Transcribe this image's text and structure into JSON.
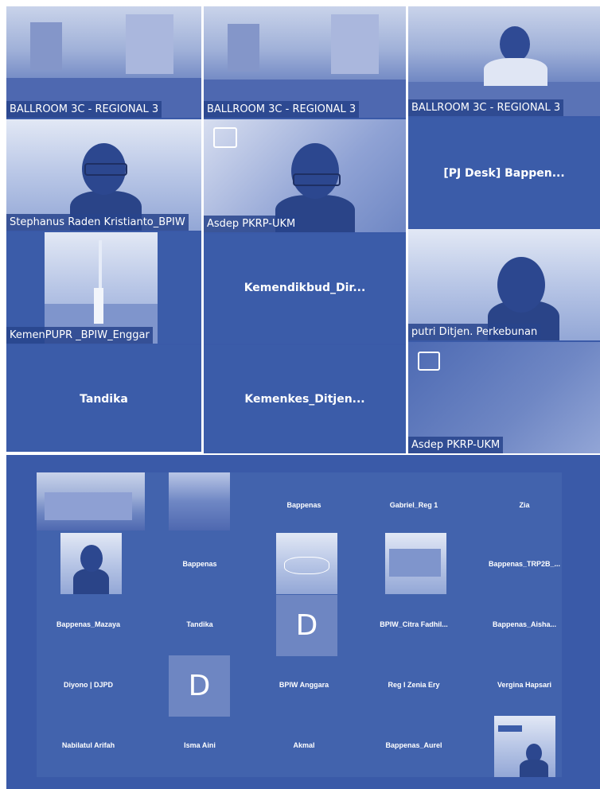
{
  "colors": {
    "panel_bg": "#3a5aa8",
    "tile_bg": "#3b5ca9",
    "text": "#ffffff"
  },
  "top_left": {
    "room_label": "BALLROOM 3C - REGIONAL 3",
    "person1_label": "Stephanus Raden Kristianto_BPIW",
    "person2_label": "KemenPUPR _BPIW_Enggar",
    "tile_name": "Tandika"
  },
  "top_middle": {
    "room_label": "BALLROOM 3C - REGIONAL 3",
    "person_label": "Asdep PKRP-UKM",
    "tile1_name": "Kemendikbud_Dir...",
    "tile2_name": "Kemenkes_Ditjen..."
  },
  "top_right": {
    "room_label": "BALLROOM 3C - REGIONAL 3",
    "tile_name": "[PJ Desk]  Bappen...",
    "person_label": "putri Ditjen. Perkebunan",
    "bottom_label": "Asdep PKRP-UKM"
  },
  "bottom_grid": {
    "row1": [
      "Bappenas",
      "Gabriel_Reg 1",
      "Zia"
    ],
    "row2": [
      "Bappenas",
      "Bappenas_TRP2B_..."
    ],
    "row3": [
      "Bappenas_Mazaya",
      "Tandika",
      "BPIW_Citra  Fadhil...",
      "Bappenas_Aisha..."
    ],
    "row4": [
      "Diyono | DJPD",
      "BPIW Anggara",
      "Reg I Zenia Ery",
      "Vergina Hapsari"
    ],
    "row5": [
      "Nabilatul Arifah",
      "Isma Aini",
      "Akmal",
      "Bappenas_Aurel"
    ],
    "avatar_letter": "D",
    "avatar_letter2": "D"
  }
}
